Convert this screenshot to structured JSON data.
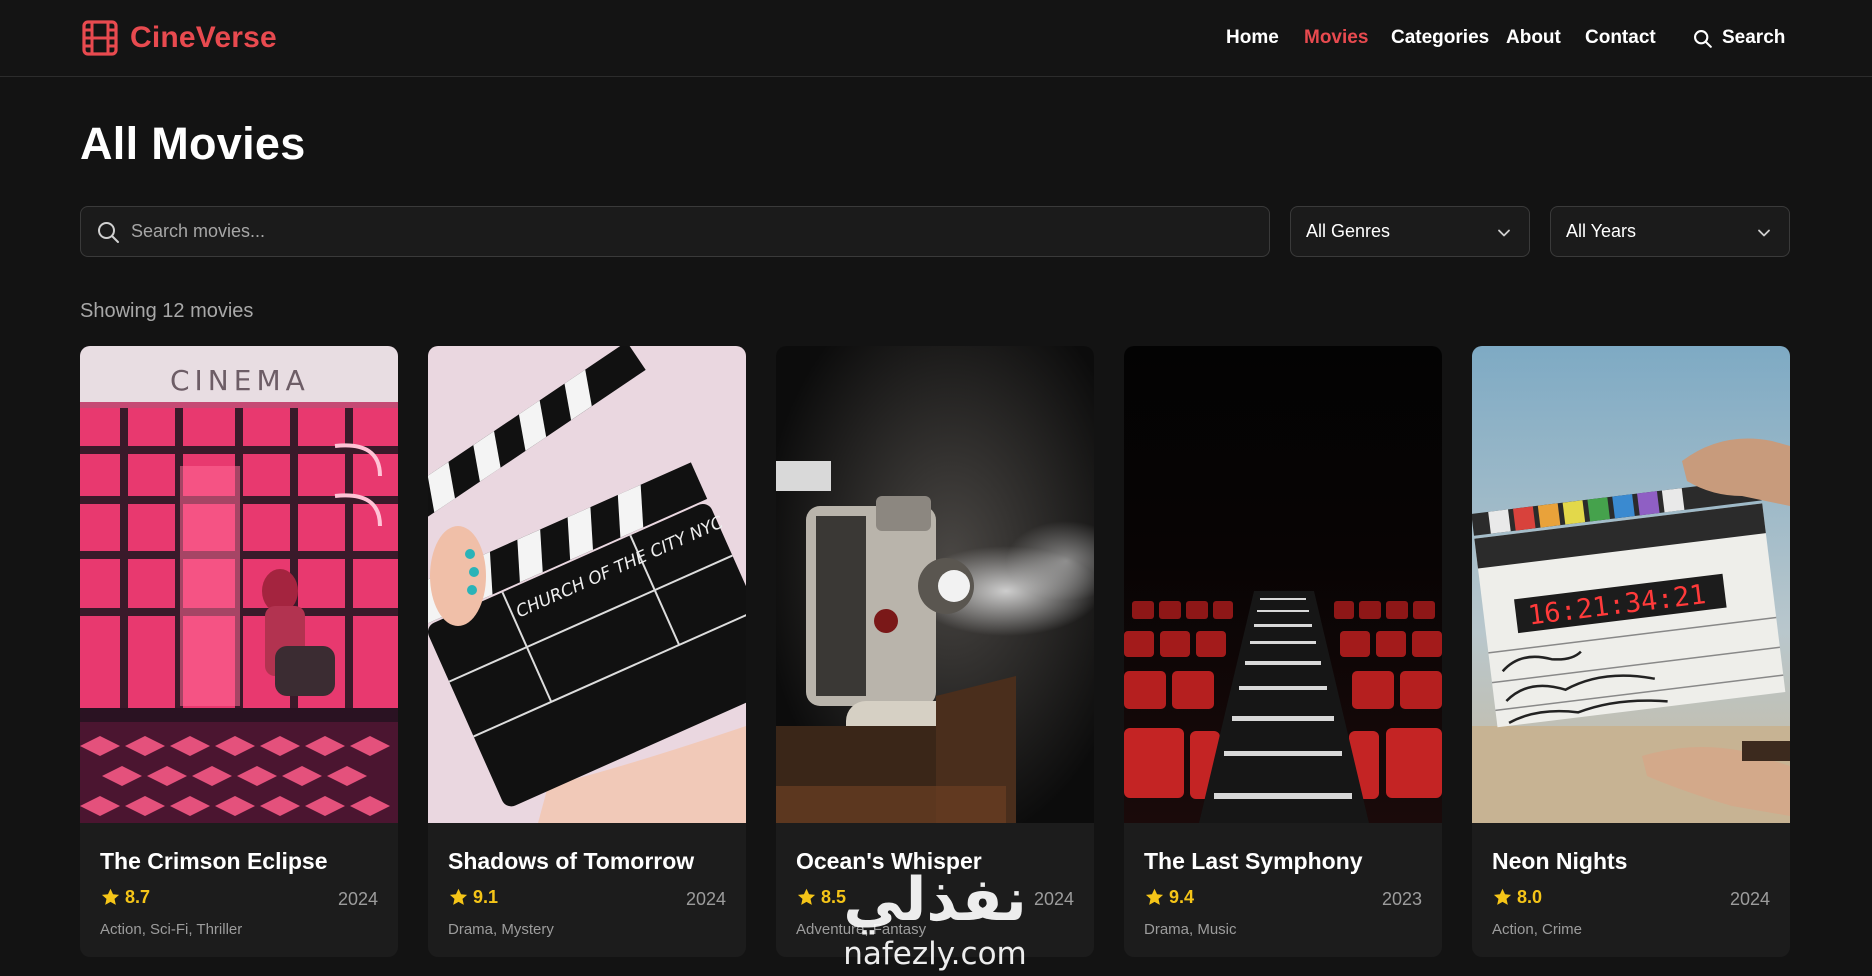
{
  "brand": {
    "name": "CineVerse",
    "accent": "#e84a4f"
  },
  "nav": {
    "items": [
      {
        "label": "Home",
        "active": false
      },
      {
        "label": "Movies",
        "active": true
      },
      {
        "label": "Categories",
        "active": false
      },
      {
        "label": "About",
        "active": false
      },
      {
        "label": "Contact",
        "active": false
      }
    ],
    "search_label": "Search"
  },
  "page": {
    "title": "All Movies",
    "search_placeholder": "Search movies...",
    "genre_filter": "All Genres",
    "year_filter": "All Years",
    "count_text": "Showing 12 movies"
  },
  "movies": [
    {
      "title": "The Crimson Eclipse",
      "rating": "8.7",
      "year": "2024",
      "genres": "Action, Sci-Fi, Thriller",
      "poster": "neon cinema entrance",
      "poster_text": "CINEMA"
    },
    {
      "title": "Shadows of Tomorrow",
      "rating": "9.1",
      "year": "2024",
      "genres": "Drama, Mystery",
      "poster": "clapperboard on pink",
      "poster_text": "CHURCH OF THE CITY NYC"
    },
    {
      "title": "Ocean's Whisper",
      "rating": "8.5",
      "year": "2024",
      "genres": "Adventure, Fantasy",
      "poster": "film projector"
    },
    {
      "title": "The Last Symphony",
      "rating": "9.4",
      "year": "2023",
      "genres": "Drama, Music",
      "poster": "red theater seats"
    },
    {
      "title": "Neon Nights",
      "rating": "8.0",
      "year": "2024",
      "genres": "Action, Crime",
      "poster": "slate clapperboard outdoors",
      "poster_text": "16:21:34:21"
    }
  ],
  "watermark": {
    "arabic": "نفذلي",
    "latin": "nafezly.com"
  },
  "colors": {
    "background": "#131313",
    "card": "#1c1c1c",
    "rating": "#f5c518",
    "muted": "#9c9c9c"
  }
}
